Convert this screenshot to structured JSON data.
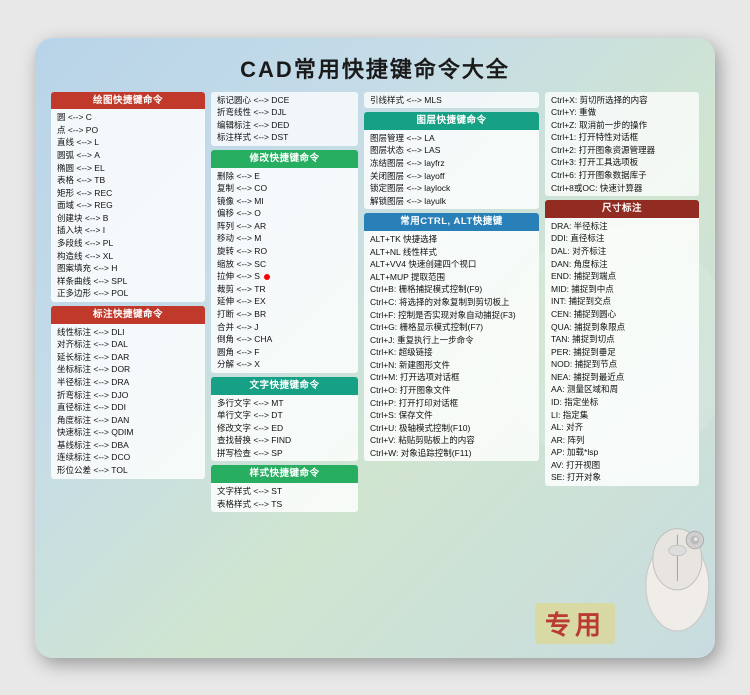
{
  "title": "CAD常用快捷键命令大全",
  "watermark": "专用",
  "col1": {
    "sections": [
      {
        "id": "draw",
        "header": "绘图快捷键命令",
        "headerClass": "red-header",
        "rows": [
          [
            "圆 <--> C",
            ""
          ],
          [
            "点 <--> PO",
            ""
          ],
          [
            "直线 <--> L",
            ""
          ],
          [
            "圆弧 <--> A",
            ""
          ],
          [
            "椭圆 <--> EL",
            ""
          ],
          [
            "表格 <--> TB",
            ""
          ],
          [
            "矩形 <--> REC",
            ""
          ],
          [
            "面域 <--> REG",
            ""
          ],
          [
            "创建块 <--> B",
            ""
          ],
          [
            "插入块 <--> I",
            ""
          ],
          [
            "多段线 <--> PL",
            ""
          ],
          [
            "构造线 <--> XL",
            ""
          ],
          [
            "图案填充 <--> H",
            ""
          ],
          [
            "样条曲线 <--> SPL",
            ""
          ],
          [
            "正多边形 <--> POL",
            ""
          ]
        ]
      },
      {
        "id": "annotate",
        "header": "标注快捷键命令",
        "headerClass": "red-header",
        "rows": [
          [
            "线性标注 <--> DLI",
            ""
          ],
          [
            "对齐标注 <--> DAL",
            ""
          ],
          [
            "延长标注 <--> DAR",
            ""
          ],
          [
            "坐标标注 <--> DOR",
            ""
          ],
          [
            "半径标注 <--> DRA",
            ""
          ],
          [
            "折弯标注 <--> DJO",
            ""
          ],
          [
            "直径标注 <--> DDI",
            ""
          ],
          [
            "角度标注 <--> DAN",
            ""
          ],
          [
            "快速标注 <--> QDIM",
            ""
          ],
          [
            "基线标注 <--> DBA",
            ""
          ],
          [
            "连续标注 <--> DCO",
            ""
          ],
          [
            "形位公差 <--> TOL",
            ""
          ]
        ]
      }
    ]
  },
  "col2": {
    "sections": [
      {
        "id": "misc1",
        "header": "",
        "headerClass": "",
        "rows": [
          [
            "标记圆心 <--> DCE",
            ""
          ],
          [
            "折弯线性 <--> DJL",
            ""
          ],
          [
            "编辑标注 <--> DED",
            ""
          ],
          [
            "标注样式 <--> DST",
            ""
          ]
        ]
      },
      {
        "id": "modify",
        "header": "修改快捷键命令",
        "headerClass": "green-header",
        "rows": [
          [
            "删除 <--> E",
            ""
          ],
          [
            "复制 <--> CO",
            ""
          ],
          [
            "镜像 <--> MI",
            ""
          ],
          [
            "偏移 <--> O",
            ""
          ],
          [
            "阵列 <--> AR",
            ""
          ],
          [
            "移动 <--> M",
            ""
          ],
          [
            "旋转 <--> RO",
            ""
          ],
          [
            "缩放 <--> SC",
            ""
          ],
          [
            "拉伸 <--> S",
            ""
          ],
          [
            "裁剪 <--> TR",
            ""
          ],
          [
            "延伸 <--> EX",
            ""
          ],
          [
            "打断 <--> BR",
            ""
          ],
          [
            "合并 <--> J",
            ""
          ],
          [
            "倒角 <--> CHA",
            ""
          ],
          [
            "圆角 <--> F",
            ""
          ],
          [
            "分解 <--> X",
            ""
          ]
        ]
      },
      {
        "id": "text",
        "header": "文字快捷键命令",
        "headerClass": "teal-header",
        "rows": [
          [
            "多行文字 <--> MT",
            ""
          ],
          [
            "单行文字 <--> DT",
            ""
          ],
          [
            "修改文字 <--> ED",
            ""
          ],
          [
            "查找替换 <--> FIND",
            ""
          ],
          [
            "拼写检查 <--> SP",
            ""
          ]
        ]
      },
      {
        "id": "style",
        "header": "样式快捷键命令",
        "headerClass": "green-header",
        "rows": [
          [
            "文字样式 <--> ST",
            ""
          ],
          [
            "表格样式 <--> TS",
            ""
          ]
        ]
      }
    ]
  },
  "col3": {
    "sections": [
      {
        "id": "layer-top",
        "rows": [
          [
            "引线样式 <--> MLS",
            ""
          ]
        ]
      },
      {
        "id": "layer",
        "header": "图层快捷键命令",
        "headerClass": "teal-header",
        "rows": [
          [
            "图层管理 <--> LA",
            ""
          ],
          [
            "图层状态 <--> LAS",
            ""
          ],
          [
            "冻结图层 <--> layfrz",
            ""
          ],
          [
            "关闭图层 <--> layoff",
            ""
          ],
          [
            "锁定图层 <--> laylock",
            ""
          ],
          [
            "解锁图层 <--> layulk",
            ""
          ]
        ]
      },
      {
        "id": "alt",
        "header": "常用CTRL, ALT快捷键",
        "headerClass": "blue-header",
        "rows": [
          [
            "ALT+TK 快捷选择",
            ""
          ],
          [
            "ALT+NL 线性样式",
            ""
          ],
          [
            "ALT+VV4 快速创建四个视口",
            ""
          ],
          [
            "ALT+MUP 提取范围",
            ""
          ],
          [
            "Ctrl+B: 栅格捕捉模式控制(F9)",
            ""
          ],
          [
            "Ctrl+C: 将选择的对象复制到剪切板上",
            ""
          ],
          [
            "Ctrl+F: 控制是否实现对象自动捕捉(F3)",
            ""
          ],
          [
            "Ctrl+G: 栅格显示模式控制(F7)",
            ""
          ],
          [
            "Ctrl+J: 重复执行上一步命令",
            ""
          ],
          [
            "Ctrl+K: 超级链接",
            ""
          ],
          [
            "Ctrl+N: 新建图形文件",
            ""
          ],
          [
            "Ctrl+M: 打开选项对话框",
            ""
          ],
          [
            "Ctrl+O: 打开图象文件",
            ""
          ],
          [
            "Ctrl+P: 打开打印对话框",
            ""
          ],
          [
            "Ctrl+S: 保存文件",
            ""
          ],
          [
            "Ctrl+U: 极轴模式控制(F10)",
            ""
          ],
          [
            "Ctrl+V: 粘贴剪贴板上的内容",
            ""
          ],
          [
            "Ctrl+W: 对象追踪控制(F11)",
            ""
          ]
        ]
      }
    ]
  },
  "col4": {
    "sections": [
      {
        "id": "ctrlx",
        "header": "",
        "rows": [
          [
            "Ctrl+X: 剪切所选择的内容",
            ""
          ],
          [
            "Ctrl+Y: 重做",
            ""
          ],
          [
            "Ctrl+Z: 取消前一步的操作",
            ""
          ],
          [
            "Ctrl+1: 打开特性对话框",
            ""
          ],
          [
            "Ctrl+2: 打开图象资源管理器",
            ""
          ],
          [
            "Ctrl+3: 打开工具选项板",
            ""
          ],
          [
            "Ctrl+6: 打开图象数据库子",
            ""
          ],
          [
            "Ctrl+8或OC: 快速计算器",
            ""
          ]
        ]
      },
      {
        "id": "dim",
        "header": "尺寸标注",
        "headerClass": "darkred-header",
        "rows": [
          [
            "DRA: 半径标注",
            ""
          ],
          [
            "DDI: 直径标注",
            ""
          ],
          [
            "DAL: 对齐标注",
            ""
          ],
          [
            "DAN: 角度标注",
            ""
          ],
          [
            "END: 捕捉到端点",
            ""
          ],
          [
            "MID: 捕捉到中点",
            ""
          ],
          [
            "INT: 捕捉到交点",
            ""
          ],
          [
            "CEN: 捕捉到圆心",
            ""
          ],
          [
            "QUA: 捕捉到象限点",
            ""
          ],
          [
            "TAN: 捕捉到切点",
            ""
          ],
          [
            "PER: 捕捉到垂足",
            ""
          ],
          [
            "NOD: 捕捉到节点",
            ""
          ],
          [
            "NEA: 捕捉到最近点",
            ""
          ],
          [
            "AA: 测量区域和周",
            ""
          ],
          [
            "ID: 指定坐标",
            ""
          ],
          [
            "LI: 指定集",
            ""
          ],
          [
            "AL: 对齐",
            ""
          ],
          [
            "AR: 阵列",
            ""
          ],
          [
            "AP: 加载*lsp",
            ""
          ],
          [
            "AV: 打开视图",
            ""
          ],
          [
            "SE: 打开对象",
            ""
          ]
        ]
      }
    ]
  }
}
